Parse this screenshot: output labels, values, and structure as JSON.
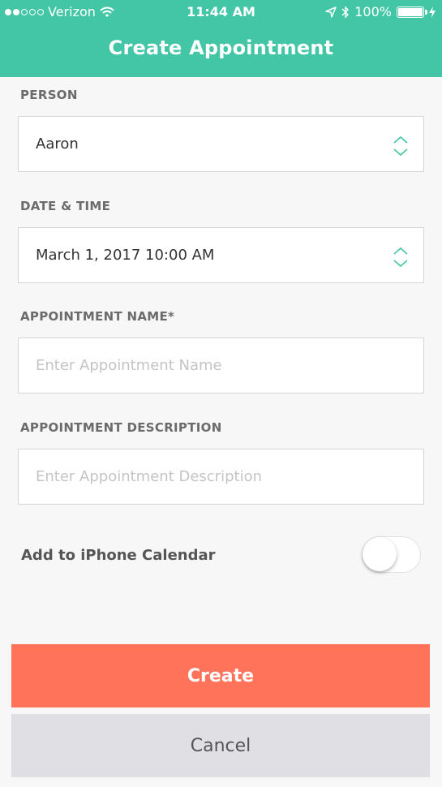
{
  "status_bar": {
    "carrier": "Verizon",
    "time": "11:44 AM",
    "battery": "100%"
  },
  "nav": {
    "title": "Create Appointment"
  },
  "person": {
    "label": "PERSON",
    "value": "Aaron"
  },
  "datetime": {
    "label": "DATE & TIME",
    "value": "March 1, 2017 10:00 AM"
  },
  "appointment_name": {
    "label": "APPOINTMENT NAME*",
    "value": "",
    "placeholder": "Enter Appointment Name"
  },
  "appointment_description": {
    "label": "APPOINTMENT DESCRIPTION",
    "value": "",
    "placeholder": "Enter Appointment Description"
  },
  "calendar_toggle": {
    "label": "Add to iPhone Calendar",
    "enabled": false
  },
  "actions": {
    "create_label": "Create",
    "cancel_label": "Cancel"
  },
  "colors": {
    "header": "#43c6a6",
    "create": "#ff735a",
    "cancel": "#e0dfe4",
    "accent": "#43c6a6"
  },
  "icons": [
    "signal-dots-icon",
    "wifi-icon",
    "location-arrow-icon",
    "bluetooth-icon",
    "battery-icon",
    "charging-bolt-icon",
    "stepper-chevrons-icon"
  ]
}
